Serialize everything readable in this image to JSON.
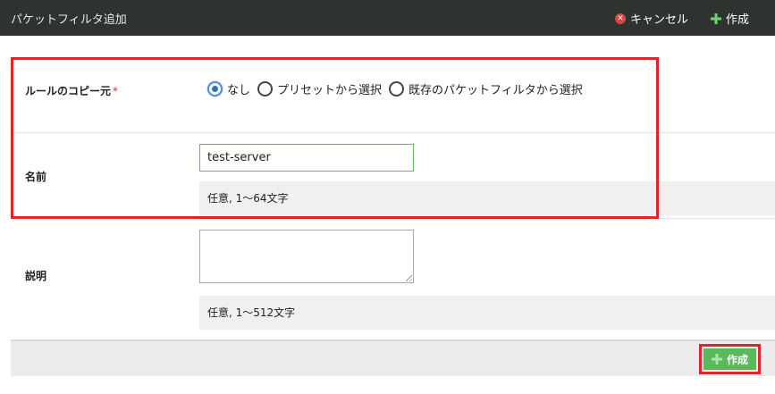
{
  "header": {
    "title": "パケットフィルタ追加",
    "cancel_label": "キャンセル",
    "create_label": "作成"
  },
  "form": {
    "copy_source": {
      "label": "ルールのコピー元",
      "required_mark": "*",
      "options": [
        {
          "label": "なし",
          "selected": true
        },
        {
          "label": "プリセットから選択",
          "selected": false
        },
        {
          "label": "既存のパケットフィルタから選択",
          "selected": false
        }
      ]
    },
    "name": {
      "label": "名前",
      "value": "test-server",
      "hint": "任意, 1〜64文字"
    },
    "description": {
      "label": "説明",
      "value": "",
      "hint": "任意, 1〜512文字"
    }
  },
  "footer": {
    "create_label": "作成"
  },
  "icons": {
    "cancel": "close-circle-icon",
    "create": "plus-icon"
  },
  "colors": {
    "header_bg": "#2e3330",
    "accent_green": "#5cb85c",
    "highlight_red": "#e0242b",
    "radio_selected": "#4a8ed8"
  }
}
